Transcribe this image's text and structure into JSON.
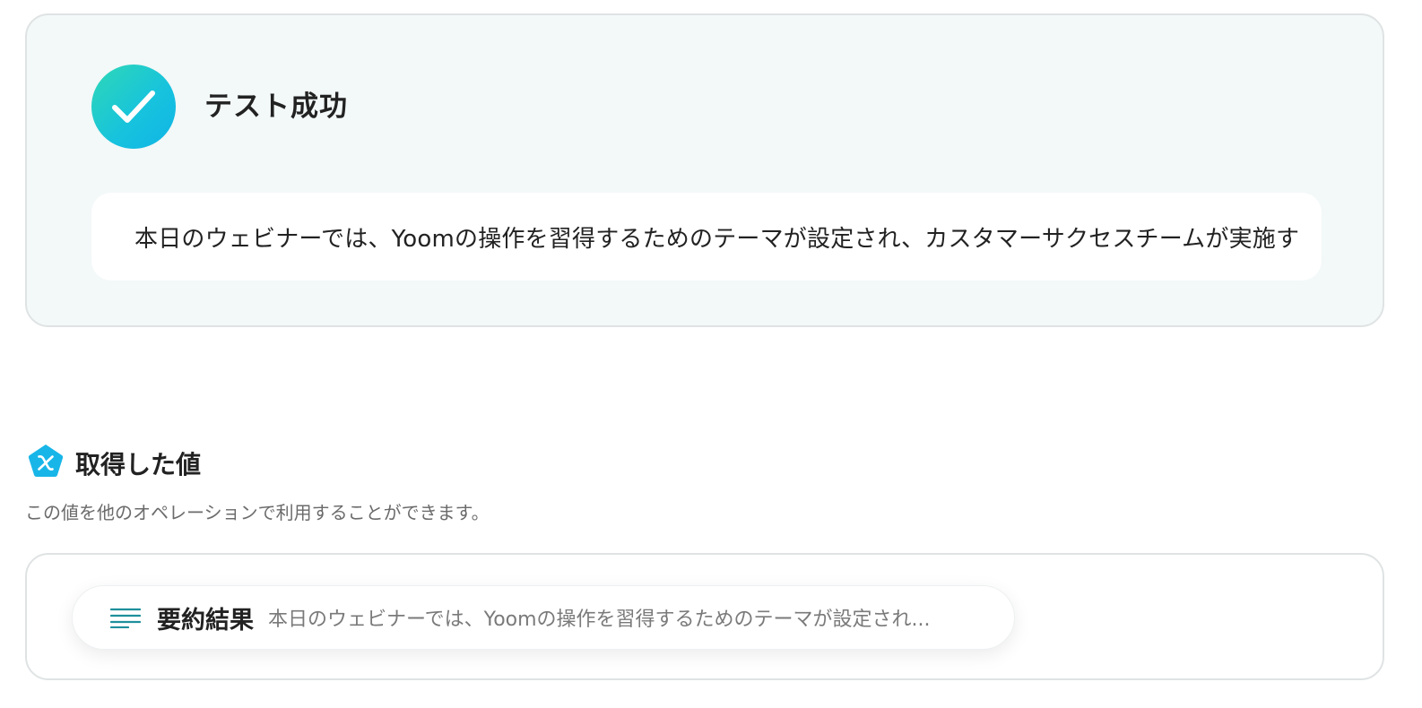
{
  "test_result": {
    "title": "テスト成功",
    "status_icon": "check-circle-icon",
    "output_text": "本日のウェビナーでは、Yoomの操作を習得するためのテーマが設定され、カスタマーサクセスチームが実施す"
  },
  "acquired_values": {
    "title": "取得した値",
    "icon": "variable-pentagon-icon",
    "description": "この値を他のオペレーションで利用することができます。",
    "items": [
      {
        "icon": "text-lines-icon",
        "label": "要約結果",
        "preview": "本日のウェビナーでは、Yoomの操作を習得するためのテーマが設定され..."
      }
    ]
  },
  "colors": {
    "accent_teal": "#16c2de",
    "accent_green": "#2fd8b6",
    "section_icon_blue": "#18b6e8",
    "card_background": "#f3f8f8",
    "card_border": "#dfe3e4"
  }
}
